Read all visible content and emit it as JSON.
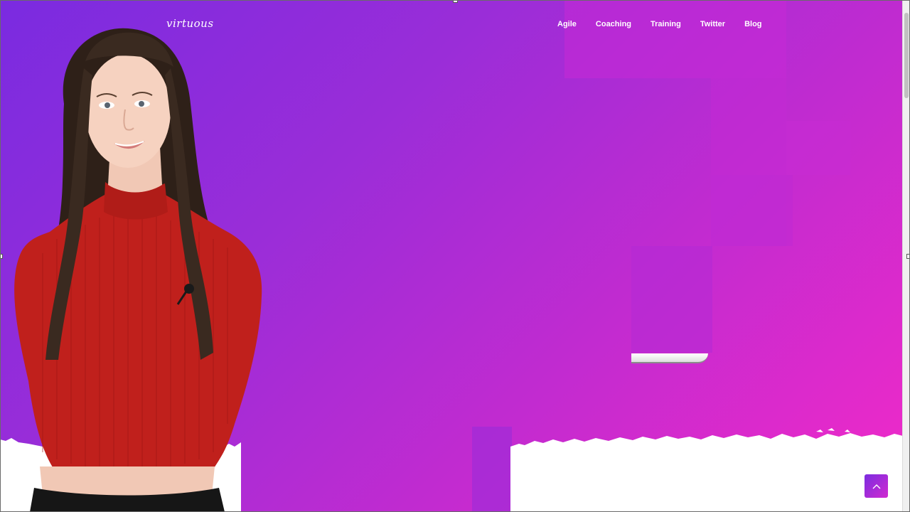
{
  "site": {
    "logo_text": "virtuous"
  },
  "nav": {
    "items": [
      {
        "label": "Agile"
      },
      {
        "label": "Coaching"
      },
      {
        "label": "Training"
      },
      {
        "label": "Twitter"
      },
      {
        "label": "Blog"
      }
    ]
  },
  "colors": {
    "gradient_start": "#7a2be0",
    "gradient_end": "#f22ac8",
    "nav_text": "#ffffff",
    "sweater": "#c0201c",
    "hair": "#3a2a20"
  },
  "icons": {
    "back_to_top": "chevron-up-icon"
  }
}
